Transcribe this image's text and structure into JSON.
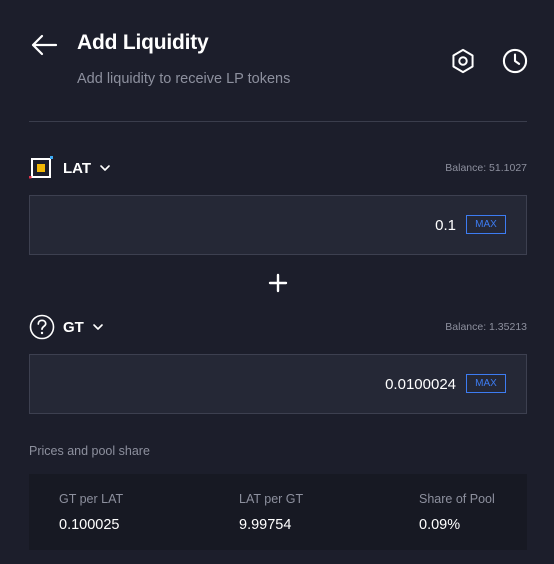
{
  "header": {
    "title": "Add Liquidity",
    "subtitle": "Add liquidity to receive LP tokens",
    "back_icon": "arrow-left-icon",
    "settings_icon": "gear-icon",
    "history_icon": "clock-icon"
  },
  "token_a": {
    "symbol": "LAT",
    "balance": "Balance: 51.1027",
    "amount": "0.1",
    "max_label": "MAX",
    "logo_icon": "lat-token-logo"
  },
  "token_b": {
    "symbol": "GT",
    "balance": "Balance: 1.35213",
    "amount": "0.0100024",
    "max_label": "MAX",
    "logo_icon": "question-circle-icon"
  },
  "pool": {
    "label": "Prices and pool share",
    "stats": [
      {
        "label": "GT per LAT",
        "value": "0.100025"
      },
      {
        "label": "LAT per GT",
        "value": "9.99754"
      },
      {
        "label": "Share of Pool",
        "value": "0.09%"
      }
    ]
  },
  "colors": {
    "background": "#1c1e2b",
    "accent": "#3d7cf2",
    "muted_text": "#8d909e",
    "token_logo": "#f2b705"
  }
}
